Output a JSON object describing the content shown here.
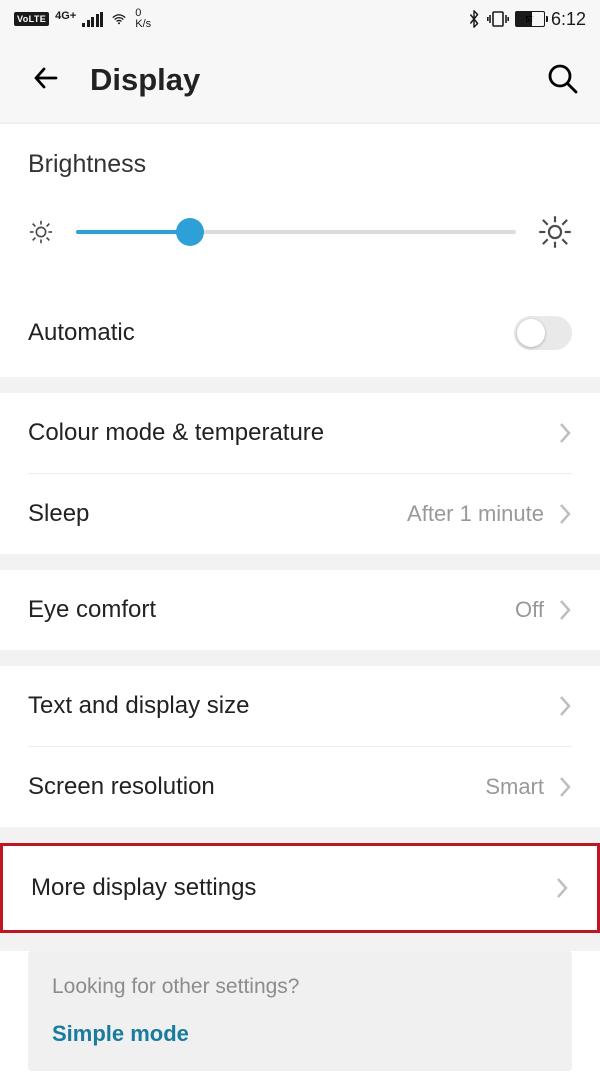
{
  "status": {
    "volte": "VoLTE",
    "network": "4G+",
    "speed_value": "0",
    "speed_unit": "K/s",
    "battery_pct": "57",
    "time": "6:12"
  },
  "header": {
    "title": "Display"
  },
  "brightness": {
    "label": "Brightness",
    "slider_pct": 26
  },
  "automatic": {
    "label": "Automatic",
    "enabled": false
  },
  "items": {
    "colour": {
      "label": "Colour mode & temperature"
    },
    "sleep": {
      "label": "Sleep",
      "value": "After 1 minute"
    },
    "eye": {
      "label": "Eye comfort",
      "value": "Off"
    },
    "text": {
      "label": "Text and display size"
    },
    "res": {
      "label": "Screen resolution",
      "value": "Smart"
    },
    "more": {
      "label": "More display settings"
    }
  },
  "suggest": {
    "question": "Looking for other settings?",
    "link": "Simple mode"
  },
  "colors": {
    "accent": "#2da0d8",
    "highlight": "#be1622"
  }
}
